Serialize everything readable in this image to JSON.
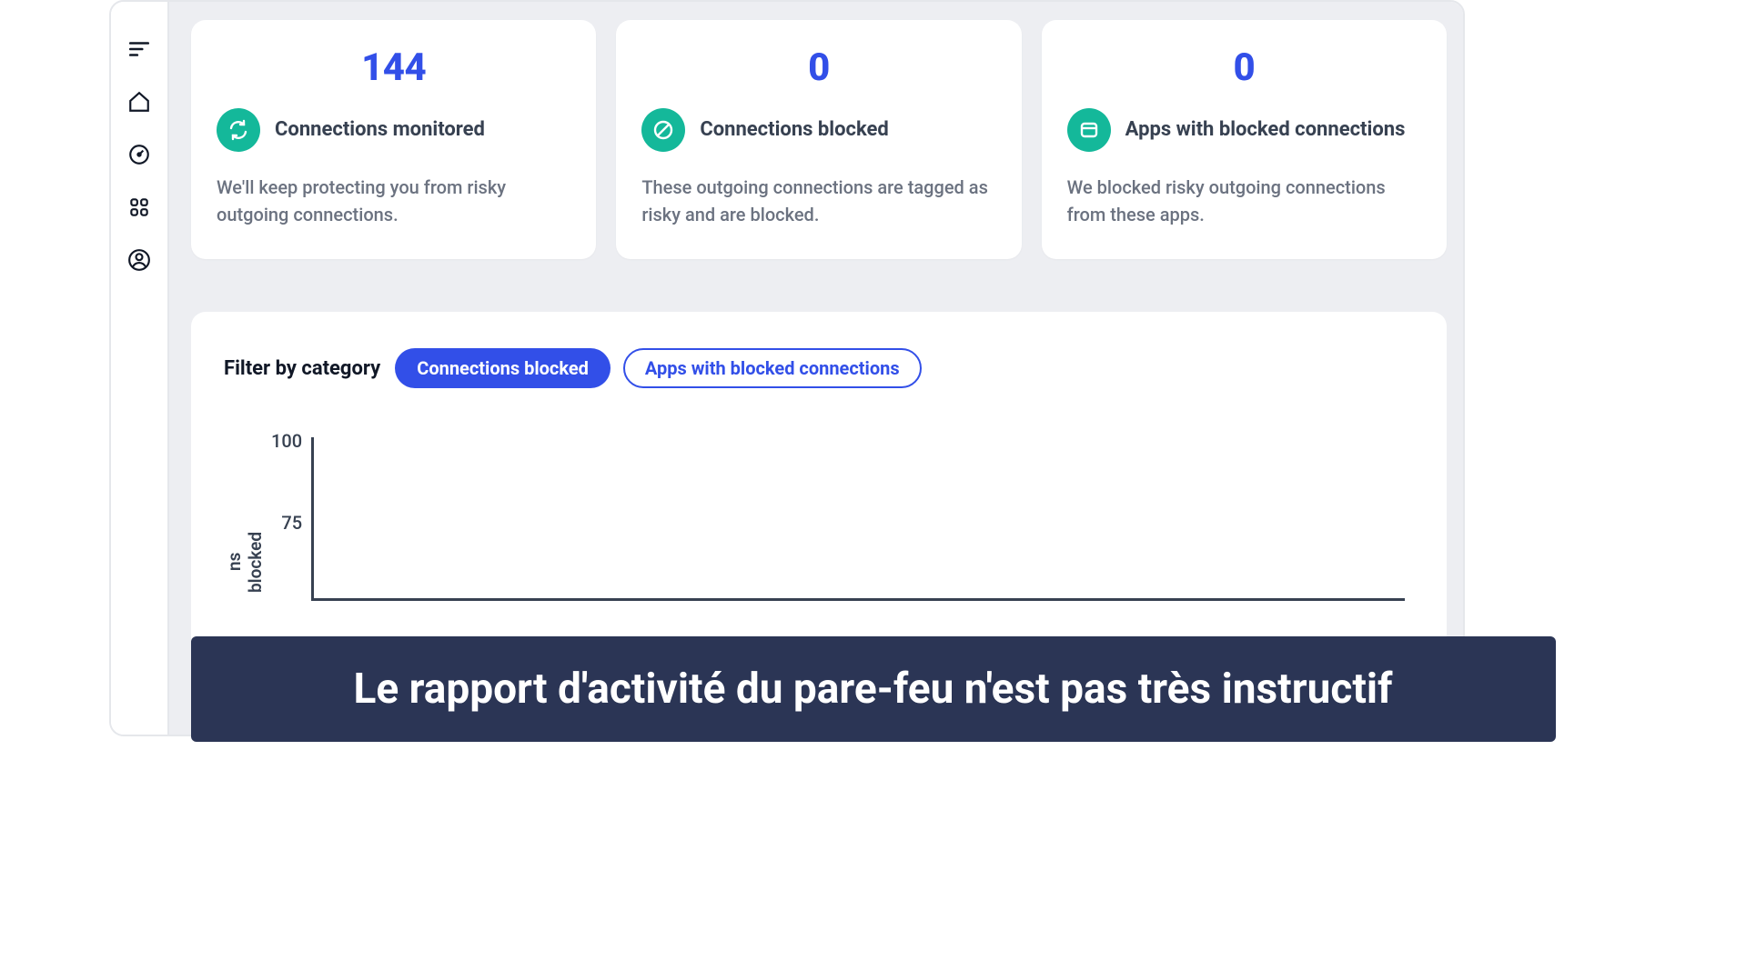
{
  "sidebar": {
    "icons": [
      "menu-icon",
      "home-icon",
      "gauge-icon",
      "apps-icon",
      "user-icon"
    ]
  },
  "cards": [
    {
      "value": "144",
      "title": "Connections monitored",
      "desc": "We'll keep protecting you from risky outgoing connections.",
      "icon": "sync-icon"
    },
    {
      "value": "0",
      "title": "Connections blocked",
      "desc": "These outgoing connections are tagged as risky and are blocked.",
      "icon": "block-icon"
    },
    {
      "value": "0",
      "title": "Apps with blocked connections",
      "desc": "We blocked risky outgoing connections from these apps.",
      "icon": "app-icon"
    }
  ],
  "chart": {
    "filter_label": "Filter by category",
    "filters": [
      "Connections blocked",
      "Apps with blocked connections"
    ],
    "active_filter": 0,
    "ylabel_visible": "ns blocked"
  },
  "chart_data": {
    "type": "bar",
    "categories": [],
    "values": [],
    "title": "",
    "xlabel": "",
    "ylabel": "Connections blocked",
    "ylim": [
      0,
      100
    ],
    "yticks": [
      100,
      75
    ]
  },
  "caption": "Le rapport d'activité du pare-feu n'est pas très instructif"
}
